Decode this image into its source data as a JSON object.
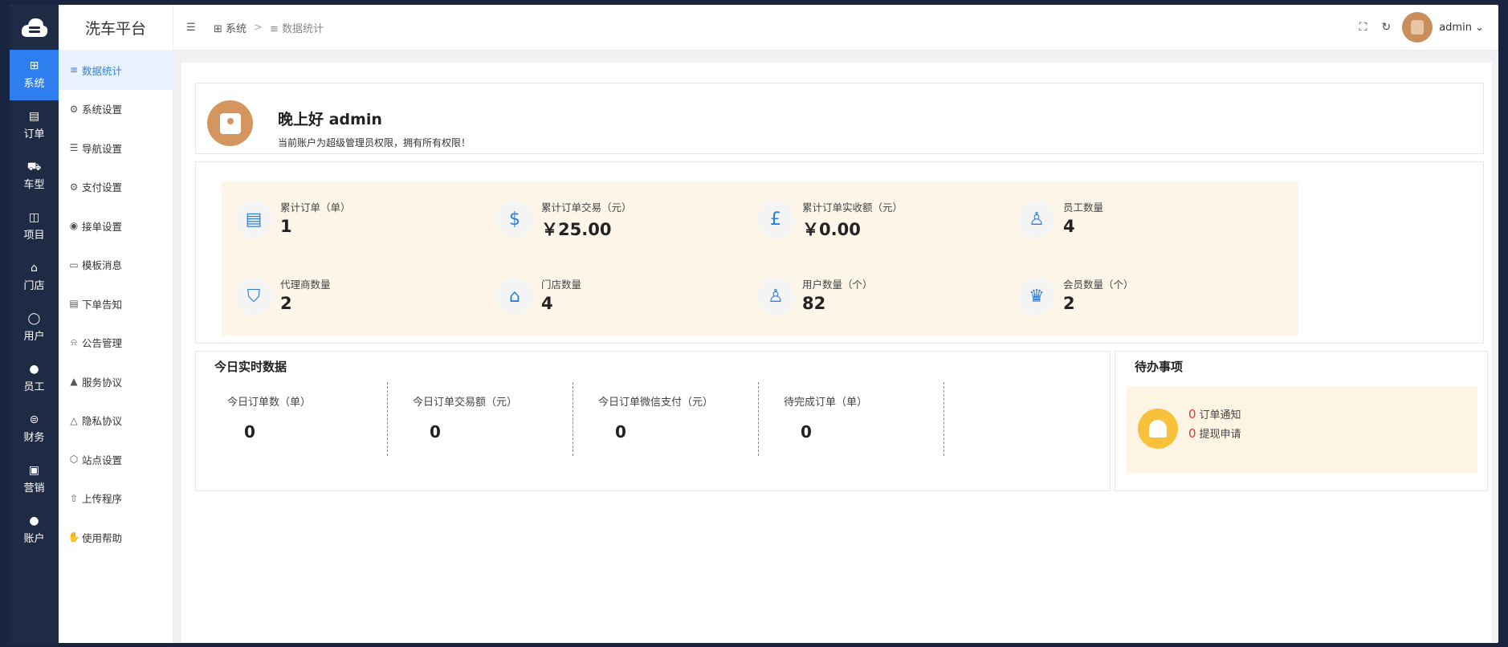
{
  "app": {
    "brand": "洗车平台"
  },
  "rail": [
    {
      "label": "系统",
      "icon": "grid-icon",
      "glyph": "⊞",
      "active": true
    },
    {
      "label": "订单",
      "icon": "document-icon",
      "glyph": "▤"
    },
    {
      "label": "车型",
      "icon": "car-icon",
      "glyph": "⛟"
    },
    {
      "label": "项目",
      "icon": "project-icon",
      "glyph": "◫"
    },
    {
      "label": "门店",
      "icon": "store-icon",
      "glyph": "⌂"
    },
    {
      "label": "用户",
      "icon": "user-icon",
      "glyph": "◯"
    },
    {
      "label": "员工",
      "icon": "staff-icon",
      "glyph": "●"
    },
    {
      "label": "财务",
      "icon": "finance-icon",
      "glyph": "⊜"
    },
    {
      "label": "营销",
      "icon": "marketing-icon",
      "glyph": "▣"
    },
    {
      "label": "账户",
      "icon": "account-icon",
      "glyph": "●"
    }
  ],
  "submenu": [
    {
      "label": "数据统计",
      "icon": "database-icon",
      "glyph": "≡",
      "active": true
    },
    {
      "label": "系统设置",
      "icon": "gear-icon",
      "glyph": "⚙"
    },
    {
      "label": "导航设置",
      "icon": "nav-icon",
      "glyph": "☰"
    },
    {
      "label": "支付设置",
      "icon": "gear-icon",
      "glyph": "⚙"
    },
    {
      "label": "接单设置",
      "icon": "order-setting-icon",
      "glyph": "◉"
    },
    {
      "label": "模板消息",
      "icon": "message-icon",
      "glyph": "▭"
    },
    {
      "label": "下单告知",
      "icon": "notice-icon",
      "glyph": "▤"
    },
    {
      "label": "公告管理",
      "icon": "bell-icon",
      "glyph": "⍾"
    },
    {
      "label": "服务协议",
      "icon": "warning-filled-icon",
      "glyph": "▲"
    },
    {
      "label": "隐私协议",
      "icon": "warning-icon",
      "glyph": "△"
    },
    {
      "label": "站点设置",
      "icon": "site-icon",
      "glyph": "⬡"
    },
    {
      "label": "上传程序",
      "icon": "upload-icon",
      "glyph": "⇧"
    },
    {
      "label": "使用帮助",
      "icon": "help-icon",
      "glyph": "✋"
    }
  ],
  "topbar": {
    "breadcrumb": [
      {
        "label": "系统"
      },
      {
        "label": "数据统计"
      }
    ],
    "separator": ">",
    "user": "admin"
  },
  "welcome": {
    "greeting": "晚上好 admin",
    "description": "当前账户为超级管理员权限，拥有所有权限！"
  },
  "stats": [
    {
      "label": "累计订单（单）",
      "value": "1",
      "icon": "receipt-icon",
      "glyph": "▤"
    },
    {
      "label": "累计订单交易（元）",
      "value": "￥25.00",
      "icon": "dollar-icon",
      "glyph": "$"
    },
    {
      "label": "累计订单实收额（元）",
      "value": "￥0.00",
      "icon": "pound-icon",
      "glyph": "£"
    },
    {
      "label": "员工数量",
      "value": "4",
      "icon": "staff-check-icon",
      "glyph": "♙"
    },
    {
      "label": "代理商数量",
      "value": "2",
      "icon": "shield-user-icon",
      "glyph": "⛉"
    },
    {
      "label": "门店数量",
      "value": "4",
      "icon": "store-icon",
      "glyph": "⌂"
    },
    {
      "label": "用户数量（个）",
      "value": "82",
      "icon": "user-icon",
      "glyph": "♙"
    },
    {
      "label": "会员数量（个）",
      "value": "2",
      "icon": "crown-icon",
      "glyph": "♛"
    }
  ],
  "today": {
    "title": "今日实时数据",
    "items": [
      {
        "label": "今日订单数（单）",
        "value": "0"
      },
      {
        "label": "今日订单交易额（元）",
        "value": "0"
      },
      {
        "label": "今日订单微信支付（元）",
        "value": "0"
      },
      {
        "label": "待完成订单（单）",
        "value": "0"
      }
    ]
  },
  "todo": {
    "title": "待办事项",
    "items": [
      {
        "count": "0",
        "label": "订单通知"
      },
      {
        "count": "0",
        "label": "提现申请"
      }
    ]
  },
  "colors": {
    "accent": "#2f7ef0",
    "rail": "#1f2a44",
    "card": "#fdf6e8",
    "alert": "#e23636"
  }
}
